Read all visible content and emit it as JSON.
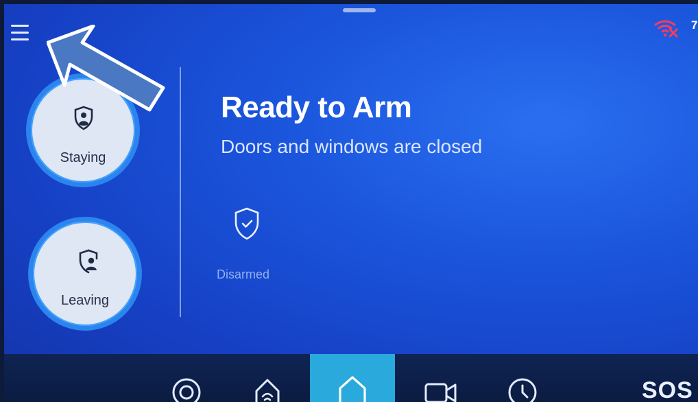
{
  "header": {
    "menu_icon": "hamburger-menu-icon",
    "wifi_icon": "wifi-error-icon",
    "status_number": "7"
  },
  "arm_modes": {
    "staying": {
      "label": "Staying",
      "icon": "shield-person-icon"
    },
    "leaving": {
      "label": "Leaving",
      "icon": "shield-person-leaving-icon"
    }
  },
  "main": {
    "title": "Ready to Arm",
    "subtitle": "Doors and windows are closed",
    "status": {
      "label": "Disarmed",
      "icon": "shield-check-icon"
    }
  },
  "bottom_nav": {
    "items": [
      {
        "icon": "target-icon"
      },
      {
        "icon": "smart-home-icon"
      },
      {
        "icon": "home-icon",
        "active": true
      },
      {
        "icon": "video-camera-icon"
      },
      {
        "icon": "clock-icon"
      }
    ],
    "sos_label": "SOS"
  },
  "colors": {
    "background": "#1a55dc",
    "nav_bar": "#0f2453",
    "nav_active": "#29a9dc",
    "button_fill": "#dfe6f4",
    "button_ring": "#2c84ee",
    "wifi_error": "#ff3b5c"
  },
  "annotation": {
    "icon": "pointing-arrow-icon"
  }
}
